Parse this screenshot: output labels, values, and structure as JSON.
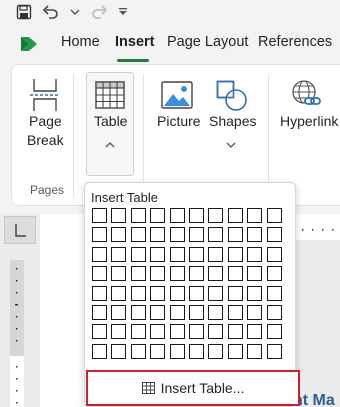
{
  "quick_access": {
    "icons": [
      "save-icon",
      "undo-icon",
      "chevron-down-icon",
      "redo-icon",
      "customize-icon"
    ]
  },
  "tabs": [
    {
      "label": "Home",
      "active": false
    },
    {
      "label": "Insert",
      "active": true
    },
    {
      "label": "Page Layout",
      "active": false
    },
    {
      "label": "References",
      "active": false
    }
  ],
  "ribbon": {
    "page_break": {
      "line1": "Page",
      "line2": "Break"
    },
    "table": {
      "label": "Table"
    },
    "picture": {
      "label": "Picture"
    },
    "shapes": {
      "label": "Shapes"
    },
    "hyperlink": {
      "label": "Hyperlink"
    },
    "pages_group_label": "Pages"
  },
  "dropdown": {
    "title": "Insert Table",
    "grid": {
      "columns": 10,
      "rows": 8
    },
    "action_label": "Insert Table..."
  },
  "document": {
    "heading_fragment": "nt Ma"
  },
  "colors": {
    "accent_green": "#2a7a3a",
    "highlight_red": "#d0202e",
    "heading_blue": "#2f5c94"
  }
}
